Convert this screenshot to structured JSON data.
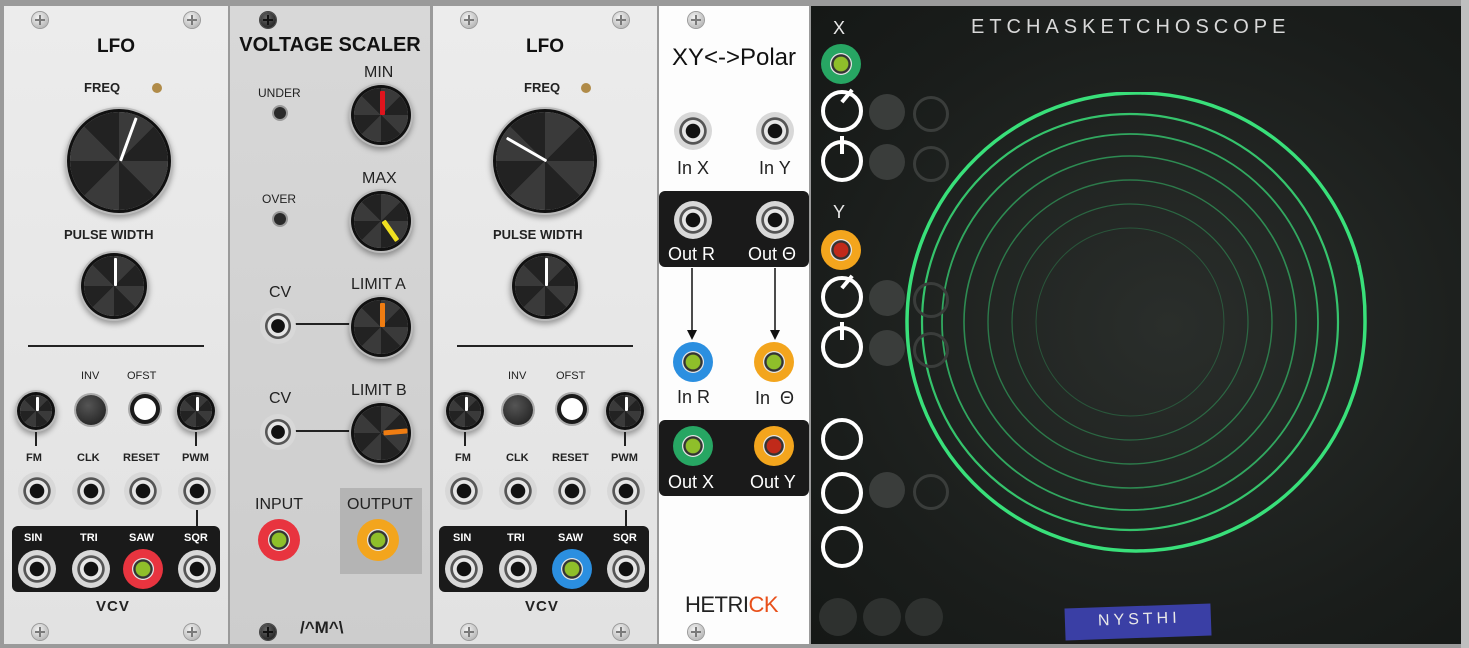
{
  "lfo1": {
    "title": "LFO",
    "freq": "FREQ",
    "pulse_width": "PULSE WIDTH",
    "inv": "INV",
    "ofst": "OFST",
    "fm": "FM",
    "clk": "CLK",
    "reset": "RESET",
    "pwm": "PWM",
    "sin": "SIN",
    "tri": "TRI",
    "saw": "SAW",
    "sqr": "SQR",
    "brand": "VCV"
  },
  "scaler": {
    "title": "VOLTAGE SCALER",
    "under": "UNDER",
    "over": "OVER",
    "min": "MIN",
    "max": "MAX",
    "cv_a": "CV",
    "limit_a": "LIMIT A",
    "cv_b": "CV",
    "limit_b": "LIMIT B",
    "input": "INPUT",
    "output": "OUTPUT",
    "brand": "/^M^\\"
  },
  "lfo2": {
    "title": "LFO",
    "freq": "FREQ",
    "pulse_width": "PULSE WIDTH",
    "inv": "INV",
    "ofst": "OFST",
    "fm": "FM",
    "clk": "CLK",
    "reset": "RESET",
    "pwm": "PWM",
    "sin": "SIN",
    "tri": "TRI",
    "saw": "SAW",
    "sqr": "SQR",
    "brand": "VCV"
  },
  "polar": {
    "title": "XY<->Polar",
    "in_x": "In X",
    "in_y": "In Y",
    "out_r": "Out R",
    "out_theta": "Out Θ",
    "in_r": "In R",
    "in_theta": "In  Θ",
    "out_x": "Out X",
    "out_y": "Out Y",
    "brand_a": "HETRI",
    "brand_b": "CK"
  },
  "scope": {
    "title": "ETCHASKETCHOSCOPE",
    "x_label": "X",
    "y_label": "Y",
    "brand": "NYSTHI"
  },
  "colors": {
    "cable_red": "#e8343f",
    "cable_blue": "#2b8fe0",
    "cable_orange": "#f3a51d",
    "cable_green": "#27a663",
    "trace_green": "#39e07a",
    "brand_orange": "#e8501a"
  }
}
